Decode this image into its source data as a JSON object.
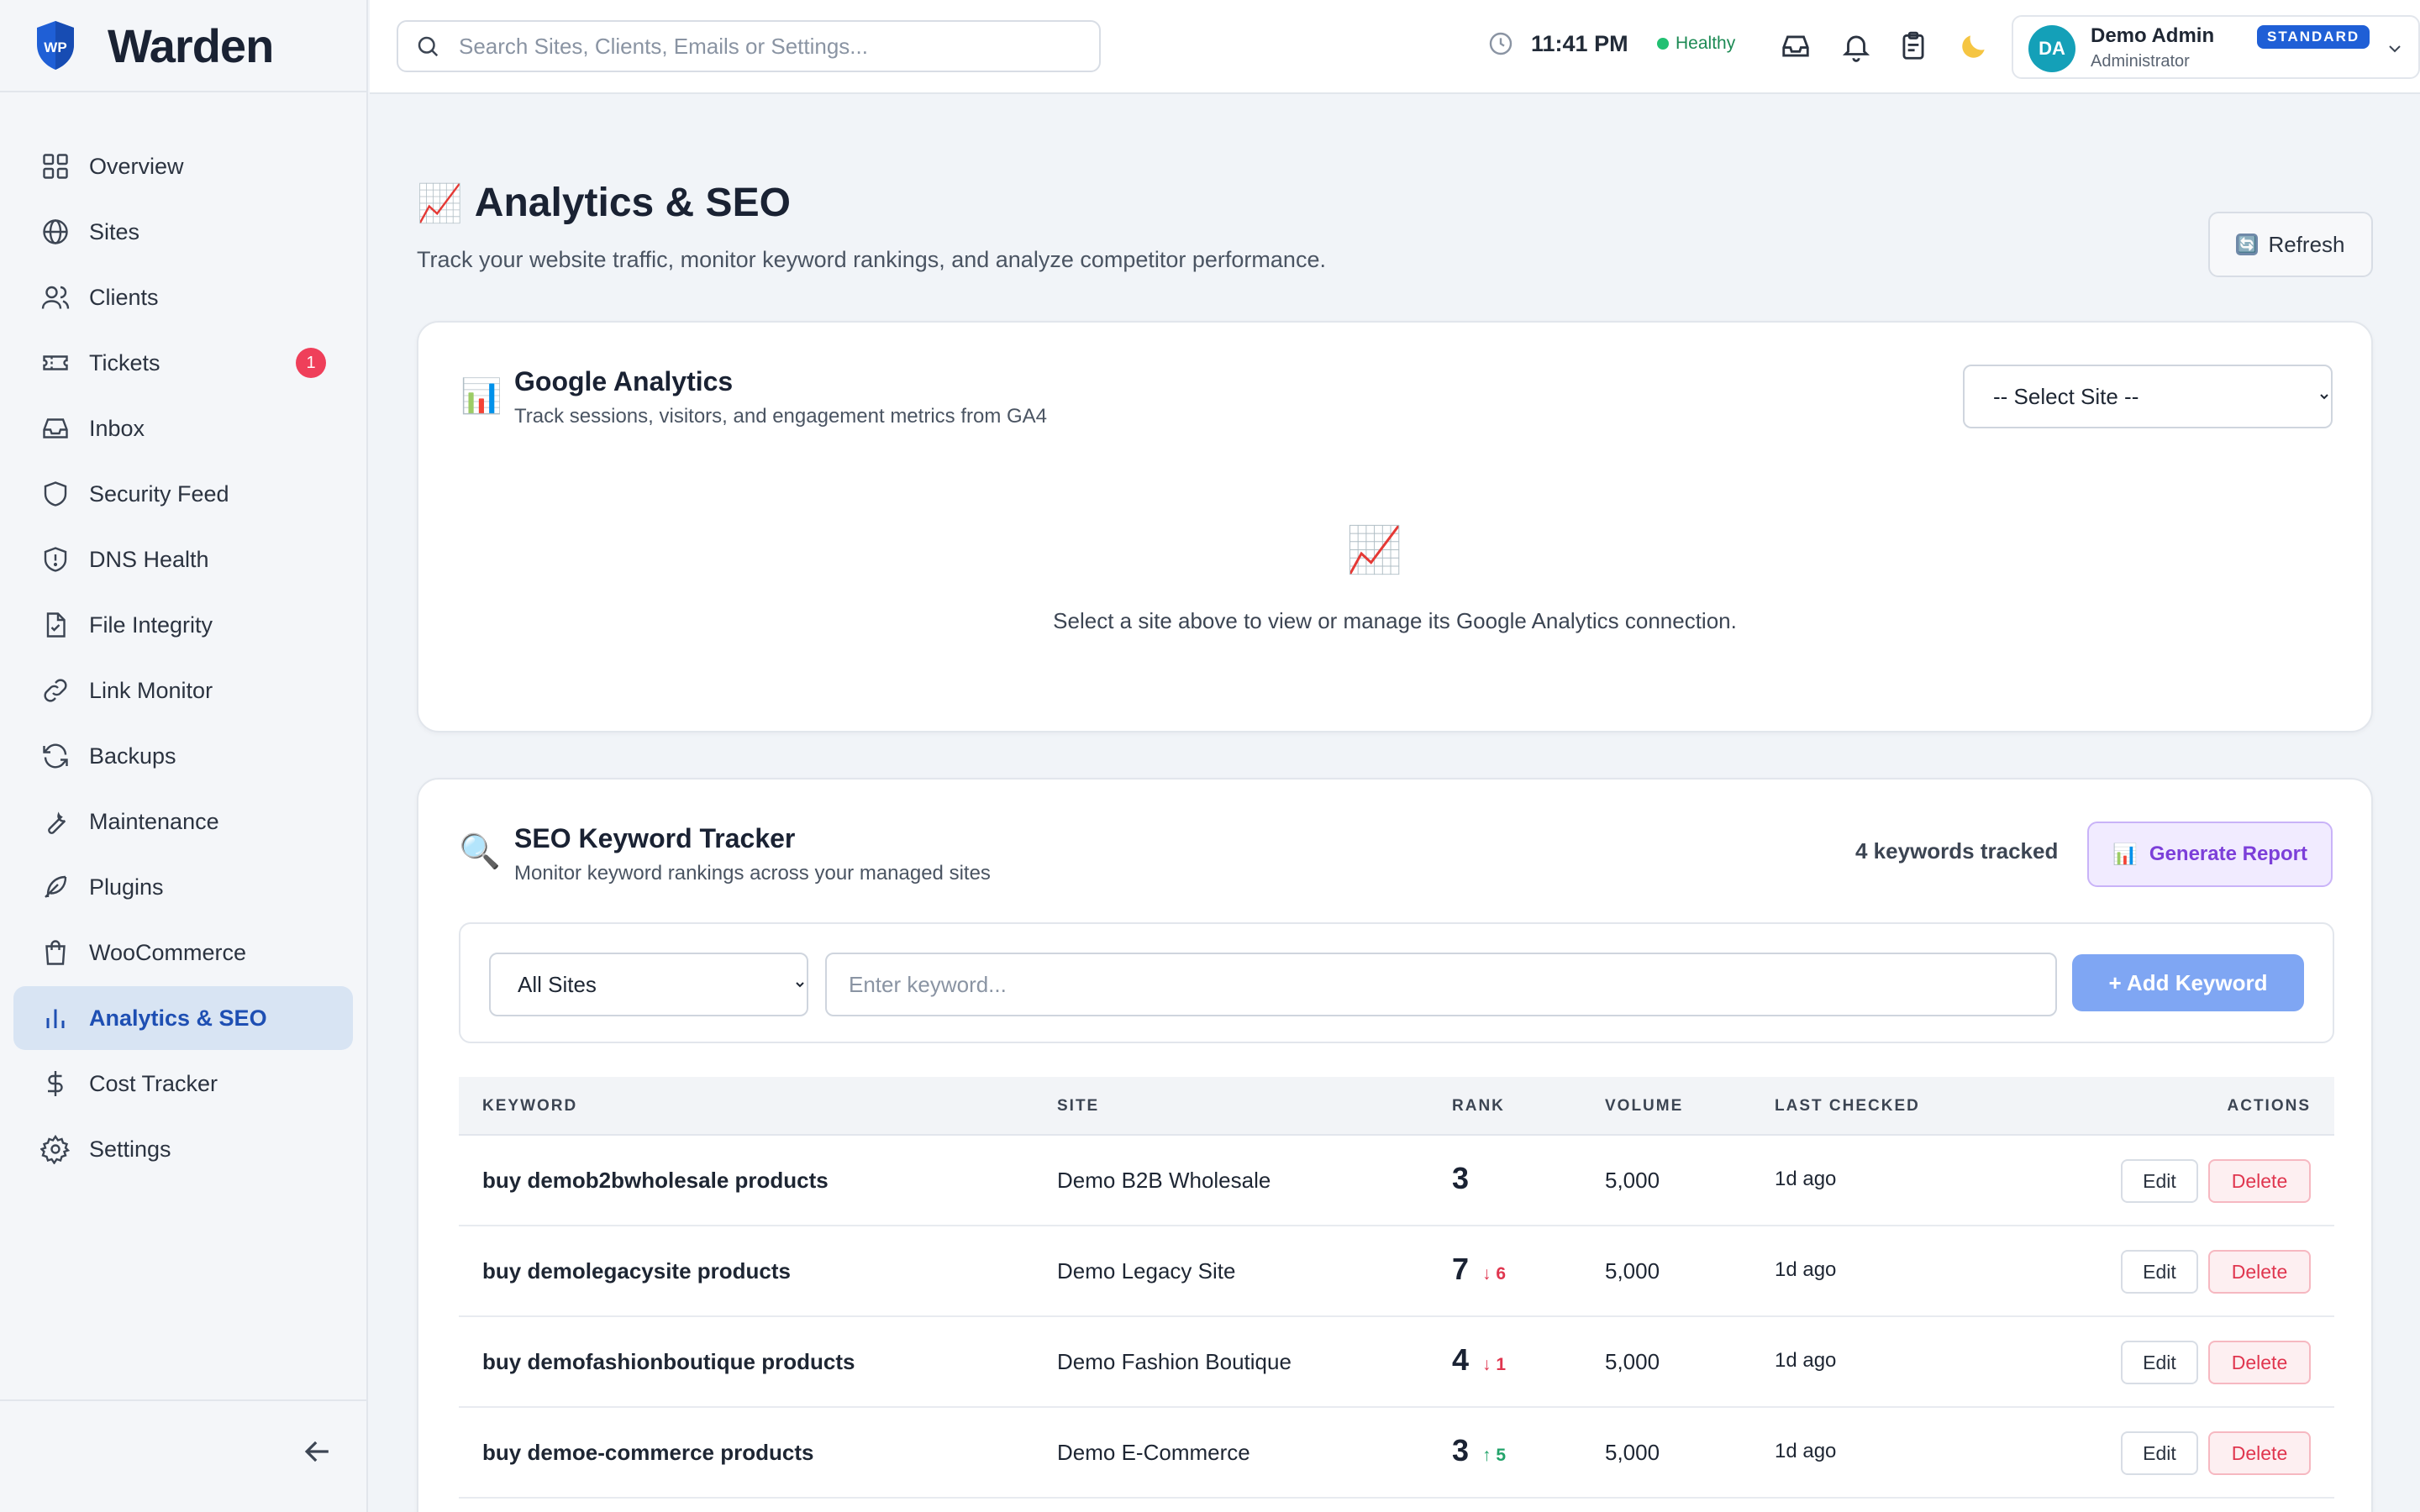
{
  "brand": {
    "name": "Warden",
    "logo_text": "WP"
  },
  "sidebar": {
    "items": [
      {
        "label": "Overview",
        "icon": "grid-icon"
      },
      {
        "label": "Sites",
        "icon": "globe-icon"
      },
      {
        "label": "Clients",
        "icon": "users-icon"
      },
      {
        "label": "Tickets",
        "icon": "ticket-icon",
        "badge": "1"
      },
      {
        "label": "Inbox",
        "icon": "inbox-icon"
      },
      {
        "label": "Security Feed",
        "icon": "shield-icon"
      },
      {
        "label": "DNS Health",
        "icon": "shield-alert-icon"
      },
      {
        "label": "File Integrity",
        "icon": "file-check-icon"
      },
      {
        "label": "Link Monitor",
        "icon": "link-icon"
      },
      {
        "label": "Backups",
        "icon": "refresh-icon"
      },
      {
        "label": "Maintenance",
        "icon": "wrench-icon"
      },
      {
        "label": "Plugins",
        "icon": "feather-icon"
      },
      {
        "label": "WooCommerce",
        "icon": "shopping-bag-icon"
      },
      {
        "label": "Analytics & SEO",
        "icon": "bar-chart-icon",
        "active": true
      },
      {
        "label": "Cost Tracker",
        "icon": "dollar-icon"
      },
      {
        "label": "Settings",
        "icon": "gear-icon"
      }
    ]
  },
  "topbar": {
    "search_placeholder": "Search Sites, Clients, Emails or Settings...",
    "time": "11:41 PM",
    "health_status": "Healthy",
    "user": {
      "initials": "DA",
      "name": "Demo Admin",
      "role": "Administrator",
      "plan": "STANDARD"
    }
  },
  "page": {
    "title": "Analytics & SEO",
    "title_emoji": "📈",
    "subtitle": "Track your website traffic, monitor keyword rankings, and analyze competitor performance.",
    "refresh_label": "Refresh",
    "refresh_emoji": "🔄"
  },
  "ga": {
    "emoji": "📊",
    "title": "Google Analytics",
    "subtitle": "Track sessions, visitors, and engagement metrics from GA4",
    "select_value": "-- Select Site --",
    "empty_emoji": "📈",
    "empty_text": "Select a site above to view or manage its Google Analytics connection."
  },
  "seo": {
    "emoji": "🔍",
    "title": "SEO Keyword Tracker",
    "subtitle": "Monitor keyword rankings across your managed sites",
    "count_text": "4 keywords tracked",
    "report_emoji": "📊",
    "report_label": "Generate Report",
    "sites_select": "All Sites",
    "keyword_placeholder": "Enter keyword...",
    "add_label": "+ Add Keyword",
    "columns": {
      "keyword": "KEYWORD",
      "site": "SITE",
      "rank": "RANK",
      "volume": "VOLUME",
      "last_checked": "LAST CHECKED",
      "actions": "ACTIONS"
    },
    "edit_label": "Edit",
    "delete_label": "Delete",
    "rows": [
      {
        "keyword": "buy demob2bwholesale products",
        "site": "Demo B2B Wholesale",
        "rank": "3",
        "change": "",
        "direction": "",
        "volume": "5,000",
        "last_checked": "1d ago"
      },
      {
        "keyword": "buy demolegacysite products",
        "site": "Demo Legacy Site",
        "rank": "7",
        "change": "↓ 6",
        "direction": "down",
        "volume": "5,000",
        "last_checked": "1d ago"
      },
      {
        "keyword": "buy demofashionboutique products",
        "site": "Demo Fashion Boutique",
        "rank": "4",
        "change": "↓ 1",
        "direction": "down",
        "volume": "5,000",
        "last_checked": "1d ago"
      },
      {
        "keyword": "buy demoe-commerce products",
        "site": "Demo E-Commerce",
        "rank": "3",
        "change": "↑ 5",
        "direction": "up",
        "volume": "5,000",
        "last_checked": "1d ago"
      }
    ]
  },
  "colors": {
    "accent": "#1f5fd6",
    "active_bg": "#d8e4f3",
    "danger": "#e0364f",
    "success": "#22a36a",
    "report": "#7c3fd9"
  }
}
